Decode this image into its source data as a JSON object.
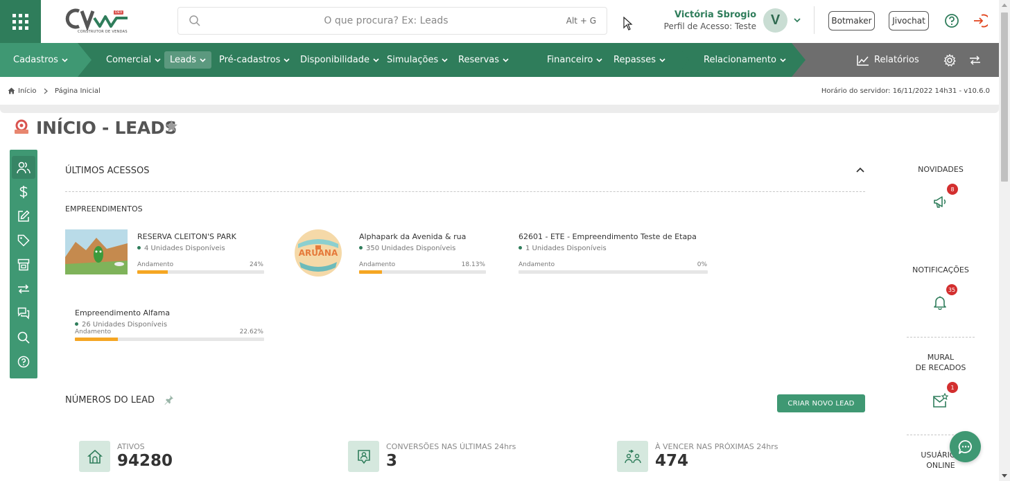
{
  "logo": {
    "text": "CV",
    "subtitle": "CONSTRUTOR DE VENDAS",
    "env_badge": "DEV"
  },
  "search": {
    "placeholder": "O que procura? Ex: Leads",
    "shortcut": "Alt + G"
  },
  "user": {
    "name": "Victória Sbrogio",
    "profile": "Perfil de Acesso: Teste",
    "initial": "V"
  },
  "header_buttons": {
    "botmaker": "Botmaker",
    "jivochat": "Jivochat"
  },
  "nav": {
    "cadastros": "Cadastros",
    "comercial": "Comercial",
    "leads": "Leads",
    "pre_cadastros": "Pré-cadastros",
    "disponibilidade": "Disponibilidade",
    "simulacoes": "Simulações",
    "reservas": "Reservas",
    "financeiro": "Financeiro",
    "repasses": "Repasses",
    "relacionamento": "Relacionamento",
    "relatorios": "Relatórios"
  },
  "breadcrumb": {
    "home": "Início",
    "current": "Página Inicial"
  },
  "server_time": "Horário do servidor: 16/11/2022 14h31 - v10.6.0",
  "page": {
    "title": "INÍCIO - LEADS"
  },
  "recent": {
    "title": "ÚLTIMOS ACESSOS",
    "subtitle": "EMPREENDIMENTOS",
    "progress_label": "Andamento",
    "items": [
      {
        "name": "RESERVA CLEITON'S PARK",
        "units": "4 Unidades Disponíveis",
        "progress_text": "24%",
        "progress": 24
      },
      {
        "name": "Alphapark da Avenida & rua",
        "units": "350 Unidades Disponíveis",
        "progress_text": "18.13%",
        "progress": 18.13,
        "logo_text": "ARUANA"
      },
      {
        "name": "62601 - ETE - Empreendimento Teste de Etapa",
        "units": "1 Unidades Disponíveis",
        "progress_text": "0%",
        "progress": 0
      },
      {
        "name": "Empreendimento Alfama",
        "units": "26 Unidades Disponíveis",
        "progress_text": "22.62%",
        "progress": 22.62
      }
    ]
  },
  "lead_numbers": {
    "title": "NÚMEROS DO LEAD",
    "create_button": "CRIAR NOVO LEAD",
    "kpis": [
      {
        "label": "ATIVOS",
        "value": "94280",
        "icon": "house-icon"
      },
      {
        "label": "CONVERSÕES NAS ÚLTIMAS 24hrs",
        "value": "3",
        "icon": "user-badge-icon"
      },
      {
        "label": "À VENCER NAS PRÓXIMAS 24hrs",
        "value": "474",
        "icon": "users-swap-icon"
      }
    ]
  },
  "widgets": {
    "novidades": {
      "title": "NOVIDADES",
      "badge": "8"
    },
    "notificacoes": {
      "title": "NOTIFICAÇÕES",
      "badge": "35"
    },
    "mural_line1": "MURAL",
    "mural_line2": "DE RECADOS",
    "mural_badge": "1",
    "online_line1": "USUÁRIOS",
    "online_line2": "ONLINE"
  },
  "colors": {
    "primary": "#2f7d5b",
    "nav_light": "#3f9873",
    "nav_gray": "#6e6e6e",
    "progress": "#f5a623",
    "badge": "#d32f2f"
  }
}
